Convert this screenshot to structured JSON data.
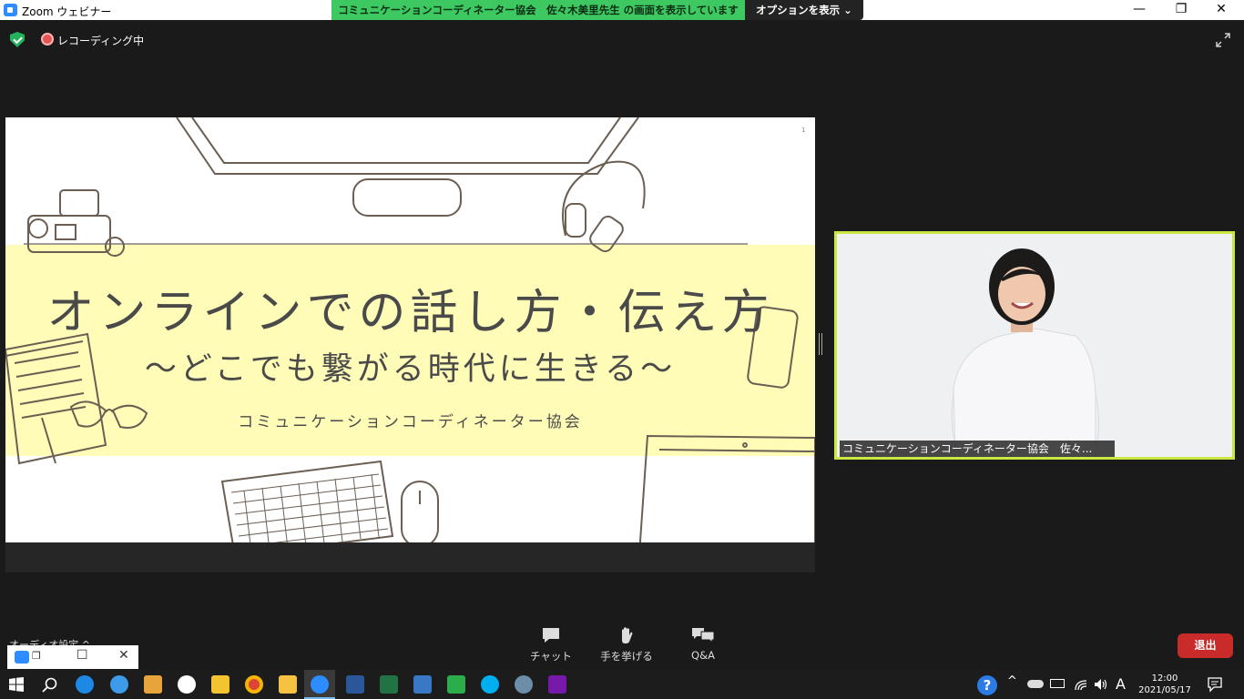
{
  "window": {
    "title": "Zoom ウェビナー",
    "share_banner": "コミュニケーションコーディネーター協会　佐々木美里先生 の画面を表示しています",
    "options_label": "オプションを表示",
    "minimize": "—",
    "restore": "❐",
    "close": "✕"
  },
  "status": {
    "recording_label": "レコーディング中"
  },
  "slide": {
    "title": "オンラインでの話し方・伝え方",
    "subtitle": "～どこでも繋がる時代に生きる～",
    "organization": "コミュニケーションコーディネーター協会",
    "page_number": "1"
  },
  "video": {
    "participant_name": "コミュニケーションコーディネーター協会　佐々..."
  },
  "toolbar": {
    "audio_settings": "オーディオ設定",
    "chat_label": "チャット",
    "raise_hand_label": "手を挙げる",
    "qa_label": "Q&A",
    "leave_label": "退出"
  },
  "taskbar": {
    "time": "12:00",
    "date": "2021/05/17",
    "ime_indicator": "A",
    "help": "?"
  },
  "colors": {
    "share_green": "#3ec862",
    "active_speaker": "#c9e843",
    "leave_red": "#c92b2b",
    "slide_band": "#fffcb8"
  }
}
